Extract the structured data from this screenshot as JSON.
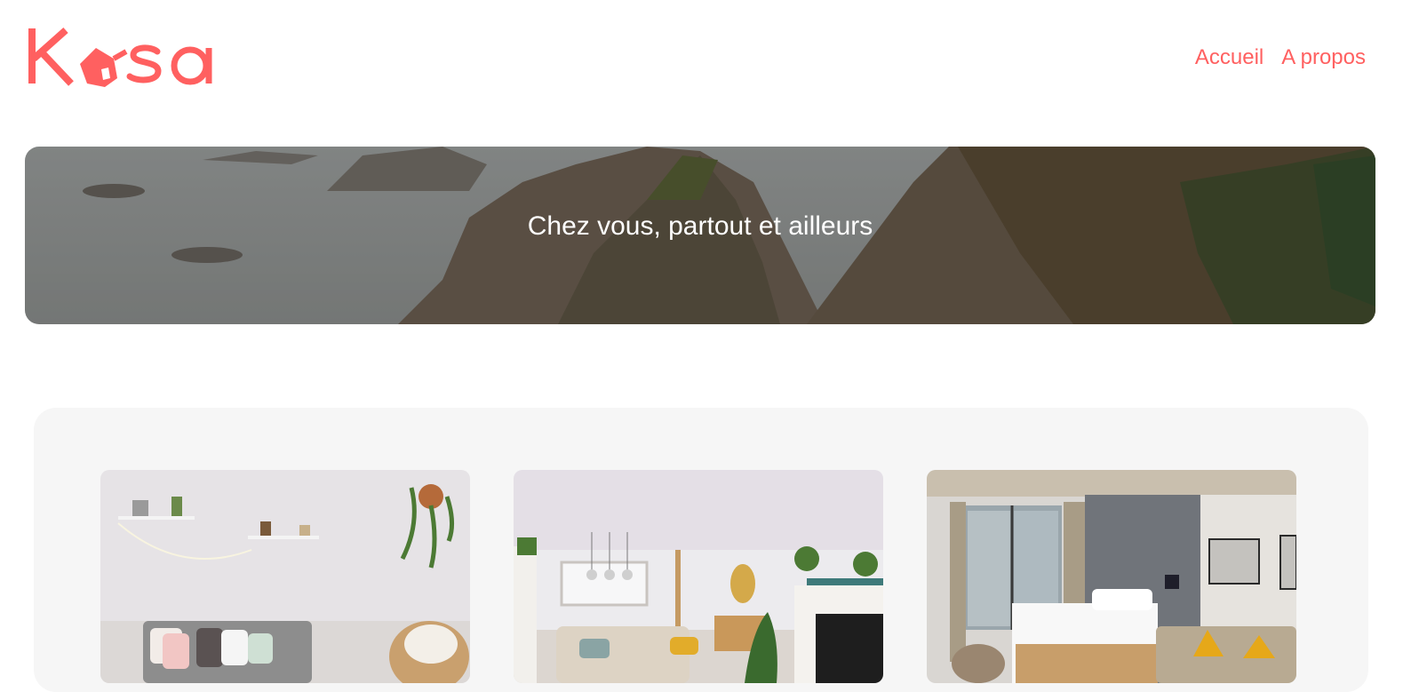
{
  "header": {
    "logo_text": "Kasa",
    "nav": [
      {
        "label": "Accueil"
      },
      {
        "label": "A propos"
      }
    ]
  },
  "banner": {
    "title": "Chez vous, partout et ailleurs"
  },
  "gallery": {
    "cards": [
      {
        "image": "living-room-boho"
      },
      {
        "image": "living-room-plants"
      },
      {
        "image": "hotel-bedroom"
      }
    ]
  },
  "colors": {
    "brand": "#FF6060",
    "gallery_bg": "#F6F6F6",
    "banner_text": "#FFFFFF"
  }
}
